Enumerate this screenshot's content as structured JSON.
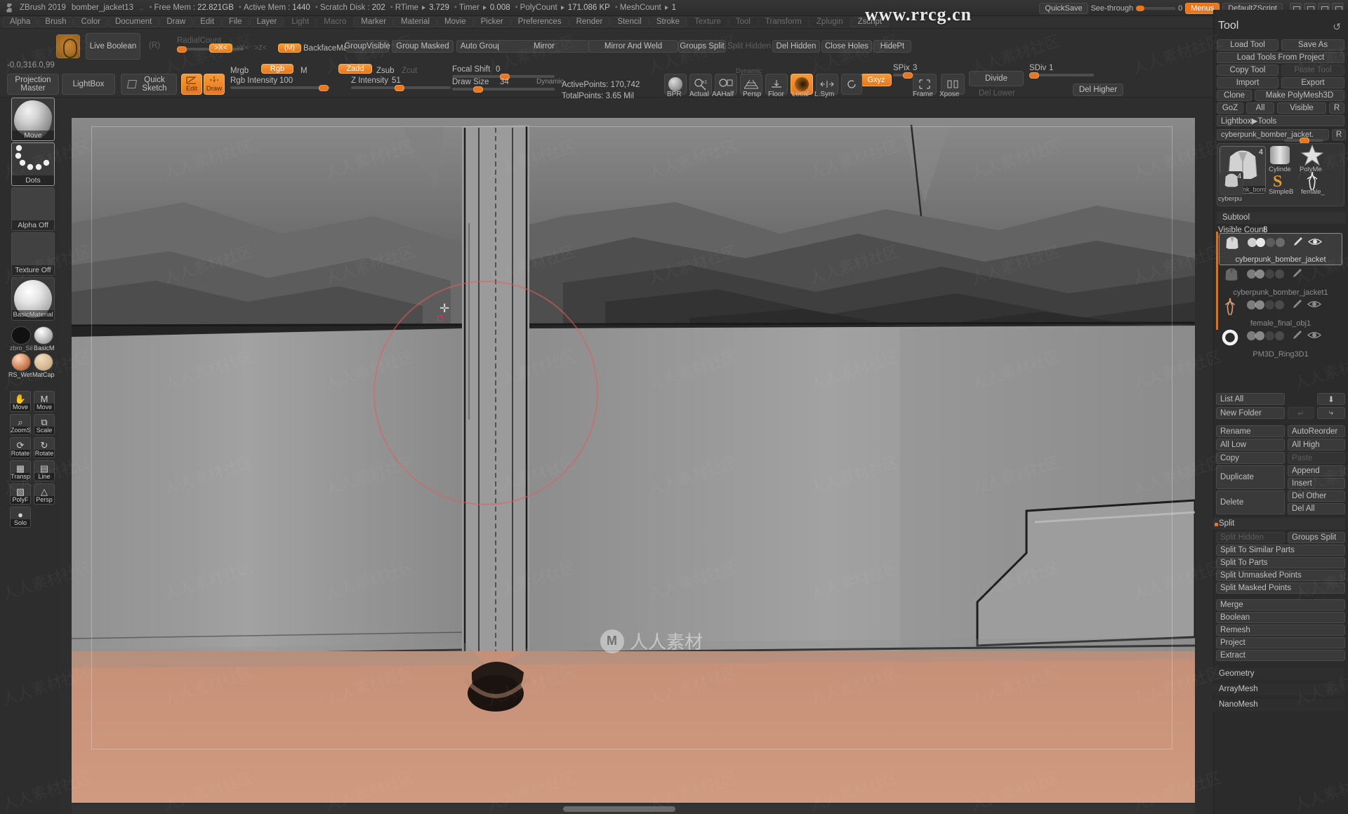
{
  "app": {
    "name": "ZBrush 2019",
    "document": "bomber_jacket13",
    "ellipsis": "..",
    "stats": [
      {
        "label": "Free Mem",
        "value": "22.821GB"
      },
      {
        "label": "Active Mem",
        "value": "1440"
      },
      {
        "label": "Scratch Disk",
        "value": "202"
      },
      {
        "label": "RTime",
        "value": "3.729",
        "arrow": true
      },
      {
        "label": "Timer",
        "value": "0.008",
        "arrow": true
      },
      {
        "label": "PolyCount",
        "value": "171.086 KP",
        "arrow": true
      },
      {
        "label": "MeshCount",
        "value": "1",
        "arrow": true
      }
    ],
    "titlebar_right": {
      "quicksave": "QuickSave",
      "see_through_label": "See-through",
      "see_through_value": "0",
      "menus": "Menus",
      "default_script": "DefaultZScript"
    }
  },
  "menubar": {
    "items": [
      {
        "label": "Alpha",
        "dim": false
      },
      {
        "label": "Brush",
        "dim": false
      },
      {
        "label": "Color",
        "dim": false
      },
      {
        "label": "Document",
        "dim": false
      },
      {
        "label": "Draw",
        "dim": false
      },
      {
        "label": "Edit",
        "dim": false
      },
      {
        "label": "File",
        "dim": false
      },
      {
        "label": "Layer",
        "dim": false
      },
      {
        "label": "Light",
        "dim": true
      },
      {
        "label": "Macro",
        "dim": true
      },
      {
        "label": "Marker",
        "dim": false
      },
      {
        "label": "Material",
        "dim": false
      },
      {
        "label": "Movie",
        "dim": false
      },
      {
        "label": "Picker",
        "dim": false
      },
      {
        "label": "Preferences",
        "dim": false
      },
      {
        "label": "Render",
        "dim": false
      },
      {
        "label": "Stencil",
        "dim": false
      },
      {
        "label": "Stroke",
        "dim": false
      },
      {
        "label": "Texture",
        "dim": true
      },
      {
        "label": "Tool",
        "dim": true
      },
      {
        "label": "Transform",
        "dim": true
      },
      {
        "label": "Zplugin",
        "dim": true
      },
      {
        "label": "Zscript",
        "dim": false
      }
    ]
  },
  "watermark": {
    "url": "www.rrcg.cn",
    "center_text": "人人素材",
    "tile_text": "人人素材社区"
  },
  "shelf": {
    "live_boolean": "Live Boolean",
    "r_key": "(R)",
    "radial_count": "RadialCount",
    "x_axis": ">X<",
    "y_axis": ">Y<",
    "z_axis": ">Z<",
    "m_axis": "(M)",
    "backface_mask": "BackfaceMask",
    "group_visible": "GroupVisible",
    "group_masked": "Group Masked",
    "auto_groups": "Auto Groups",
    "mirror": "Mirror",
    "mirror_and_weld": "Mirror And Weld",
    "groups_split": "Groups Split",
    "split_hidden": "Split Hidden",
    "del_hidden": "Del Hidden",
    "close_holes": "Close Holes",
    "hide_pt": "HidePt",
    "coords": "-0.0,316.0,99",
    "projection_master": "Projection Master",
    "lightbox": "LightBox",
    "quick_sketch": "Quick Sketch",
    "edit": "Edit",
    "draw": "Draw",
    "mrgb": "Mrgb",
    "rgb": "Rgb",
    "m": "M",
    "zadd": "Zadd",
    "zsub": "Zsub",
    "zcut": "Zcut",
    "rgb_intensity_label": "Rgb Intensity",
    "rgb_intensity_value": "100",
    "z_intensity_label": "Z Intensity",
    "z_intensity_value": "51",
    "focal_shift_label": "Focal Shift",
    "focal_shift_value": "0",
    "draw_size_label": "Draw Size",
    "draw_size_value": "34",
    "dynamic": "Dynamic",
    "active_points": "ActivePoints: 170,742",
    "total_points": "TotalPoints: 3.65 Mil",
    "bpr": "BPR",
    "actual": "Actual",
    "persp": "Persp",
    "dynamic_badge": "Dynamic",
    "floor": "Floor",
    "local": "Local",
    "l_sym": "L.Sym",
    "frame": "Frame",
    "xpose": "Xpose",
    "divide": "Divide",
    "del_lower": "Del Lower",
    "del_higher": "Del Higher",
    "gxyz": "Gxyz",
    "spix_label": "SPix",
    "spix_value": "3",
    "sdiv_label": "SDiv",
    "sdiv_value": "1"
  },
  "leftbar": {
    "brush": {
      "label": "Move",
      "name": "brush-slot"
    },
    "stroke": {
      "label": "Dots",
      "name": "stroke-slot"
    },
    "alpha": {
      "label": "Alpha Off",
      "name": "alpha-slot"
    },
    "texture": {
      "label": "Texture Off",
      "name": "texture-slot"
    },
    "material": {
      "label": "BasicMaterial",
      "name": "material-slot"
    },
    "swatches": [
      {
        "label": "zbro_Sil"
      },
      {
        "label": "BasicM"
      },
      {
        "label": "RS_Wet"
      },
      {
        "label": "MatCap"
      }
    ],
    "transforms": [
      {
        "label": "Move"
      },
      {
        "label": "Move"
      },
      {
        "label": "ZoomSD"
      },
      {
        "label": "Scale"
      },
      {
        "label": "Rotate"
      },
      {
        "label": "Rotate"
      },
      {
        "label": "Transp"
      },
      {
        "label": "Line Fill"
      },
      {
        "label": "PolyF"
      },
      {
        "label": "Persp"
      },
      {
        "label": "Solo"
      }
    ]
  },
  "tool_panel": {
    "title": "Tool",
    "refresh_icon": "refresh-icon",
    "buttons": {
      "load_tool": "Load Tool",
      "save_as": "Save As",
      "load_tools_from_project": "Load Tools From Project",
      "copy_tool": "Copy Tool",
      "paste_tool": "Paste Tool",
      "import": "Import",
      "export": "Export",
      "clone": "Clone",
      "make_polymesh3d": "Make PolyMesh3D",
      "goz": "GoZ",
      "all": "All",
      "visible": "Visible",
      "r": "R",
      "lightbox_tools": "Lightbox▶Tools"
    },
    "current_tool_name": "cyberpunk_bomber_jacket.",
    "current_tool_r": "R",
    "tool_thumbs": [
      {
        "label": "cyberpunk_bom",
        "badge": "4"
      },
      {
        "label": "Cylinde",
        "badge": ""
      },
      {
        "label": "PolyMe",
        "badge": ""
      },
      {
        "label": "SimpleB",
        "badge": ""
      },
      {
        "label": "female_",
        "badge": ""
      },
      {
        "label": "cyberpu",
        "badge": "4"
      }
    ],
    "subtool": {
      "section": "Subtool",
      "visible_count_label": "Visible Count",
      "visible_count_value": "8",
      "items": [
        {
          "name": "cyberpunk_bomber_jacket",
          "selected": true,
          "has_eye": true
        },
        {
          "name": "cyberpunk_bomber_jacket1",
          "selected": false,
          "has_eye": false
        },
        {
          "name": "female_final_obj1",
          "selected": false,
          "has_eye": true
        },
        {
          "name": "PM3D_Ring3D1",
          "selected": false,
          "has_eye": true
        }
      ],
      "list_all": "List All",
      "new_folder": "New Folder",
      "rename": "Rename",
      "auto_reorder": "AutoReorder",
      "all_low": "All Low",
      "all_high": "All High",
      "copy": "Copy",
      "paste": "Paste",
      "duplicate": "Duplicate",
      "append": "Append",
      "insert": "Insert",
      "delete": "Delete",
      "del_other": "Del Other",
      "del_all": "Del All"
    },
    "split": {
      "section": "Split",
      "split_hidden": "Split Hidden",
      "groups_split": "Groups Split",
      "split_to_similar_parts": "Split To Similar Parts",
      "split_to_parts": "Split To Parts",
      "split_unmasked_points": "Split Unmasked Points",
      "split_masked_points": "Split Masked Points",
      "merge": "Merge",
      "boolean": "Boolean",
      "remesh": "Remesh",
      "project": "Project",
      "extract": "Extract"
    },
    "sections": {
      "geometry": "Geometry",
      "array_mesh": "ArrayMesh",
      "nano_mesh": "NanoMesh"
    }
  },
  "colors": {
    "accent": "#e87722",
    "panel": "#2b2b2b",
    "button": "#3a3a3a",
    "text": "#c0c0c0",
    "canvas": "#4a4a4a"
  }
}
